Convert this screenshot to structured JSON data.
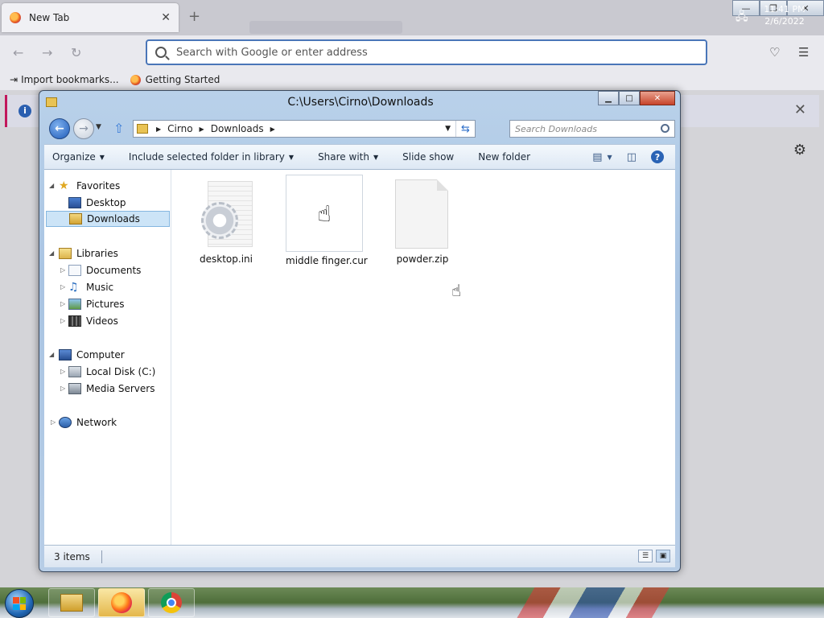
{
  "firefox": {
    "tab_title": "New Tab",
    "tab_close": "✕",
    "new_tab": "+",
    "url_placeholder": "Search with Google or enter address",
    "bookmarks": [
      {
        "label": "Import bookmarks..."
      },
      {
        "label": "Getting Started"
      }
    ],
    "window_controls": {
      "minimize": "—",
      "maximize": "❐",
      "close": "✕"
    }
  },
  "explorer": {
    "title": "C:\\Users\\Cirno\\Downloads",
    "controls": {
      "minimize": "▁",
      "maximize": "□",
      "close": "✕"
    },
    "breadcrumb": [
      "Cirno",
      "Downloads"
    ],
    "search_placeholder": "Search Downloads",
    "toolbar": {
      "organize": "Organize",
      "include": "Include selected folder in library",
      "share": "Share with",
      "slideshow": "Slide show",
      "new_folder": "New folder",
      "help": "?"
    },
    "nav": {
      "favorites": "Favorites",
      "desktop": "Desktop",
      "downloads": "Downloads",
      "libraries": "Libraries",
      "documents": "Documents",
      "music": "Music",
      "pictures": "Pictures",
      "videos": "Videos",
      "computer": "Computer",
      "local_disk": "Local Disk (C:)",
      "media_servers": "Media Servers",
      "network": "Network"
    },
    "files": [
      {
        "name": "desktop.ini",
        "icon": "settings-file-icon"
      },
      {
        "name": "middle finger.cur",
        "icon": "cursor-file-icon"
      },
      {
        "name": "powder.zip",
        "icon": "blank-file-icon"
      }
    ],
    "status": "3 items"
  },
  "taskbar": {
    "time": "11:41 PM",
    "date": "2/6/2022"
  }
}
